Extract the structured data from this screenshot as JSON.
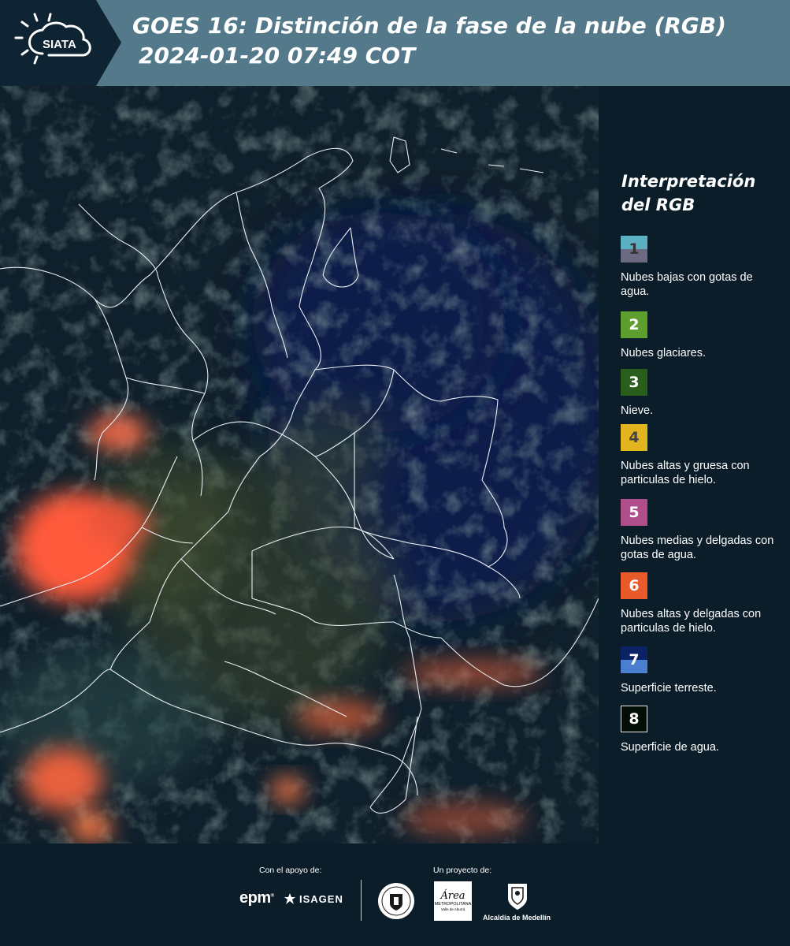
{
  "header": {
    "logo_text": "SIATA",
    "title_line1": "GOES 16: Distinción de la fase de la nube (RGB)",
    "title_line2": "2024-01-20 07:49 COT"
  },
  "legend": {
    "title": "Interpretación del RGB",
    "items": [
      {
        "number": "1",
        "text": "Nubes bajas con gotas de agua.",
        "colors": [
          "#5bb0c2",
          "#6c6a83"
        ]
      },
      {
        "number": "2",
        "text": "Nubes glaciares.",
        "colors": [
          "#5d9e2e"
        ]
      },
      {
        "number": "3",
        "text": "Nieve.",
        "colors": [
          "#2a5e1d"
        ]
      },
      {
        "number": "4",
        "text": "Nubes altas y gruesa con particulas de hielo.",
        "colors": [
          "#e2b41d"
        ]
      },
      {
        "number": "5",
        "text": "Nubes medias y delgadas con gotas de agua.",
        "colors": [
          "#b04e8c"
        ]
      },
      {
        "number": "6",
        "text": "Nubes altas y delgadas con particulas de hielo.",
        "colors": [
          "#e95a2b"
        ]
      },
      {
        "number": "7",
        "text": "Superficie terreste.",
        "colors": [
          "#0b2364",
          "#4a7fd0"
        ]
      },
      {
        "number": "8",
        "text": "Superficie de agua.",
        "colors": [
          "#020d06"
        ]
      }
    ]
  },
  "footer": {
    "support_label": "Con el apoyo de:",
    "project_label": "Un proyecto de:",
    "epm": "epm",
    "isagen": "ISAGEN",
    "area_word": "Área",
    "area_sub": "METROPOLITANA",
    "area_sub2": "Valle de Aburrá",
    "alcaldia": "Alcaldía de Medellín"
  }
}
